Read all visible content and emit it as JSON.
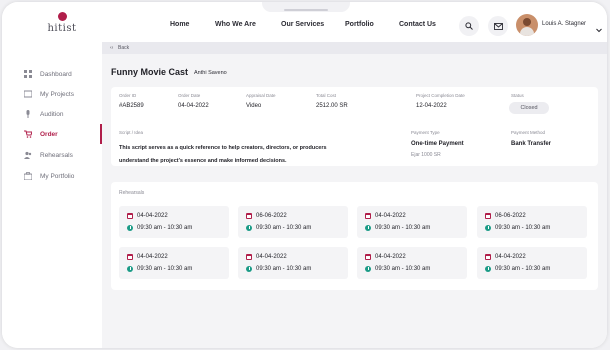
{
  "brand": {
    "logo_text": "hitist",
    "accent": "#b01e4a",
    "time_icon_color": "#1a9b86"
  },
  "nav": {
    "links": [
      "Home",
      "Who We Are",
      "Our Services",
      "Portfolio",
      "Contact Us"
    ],
    "user_name": "Louis A. Stagner"
  },
  "sidebar": {
    "items": [
      {
        "label": "Dashboard",
        "icon": "grid-icon"
      },
      {
        "label": "My Projects",
        "icon": "folder-icon"
      },
      {
        "label": "Audition",
        "icon": "mic-icon"
      },
      {
        "label": "Order",
        "icon": "cart-icon",
        "active": true
      },
      {
        "label": "Rehearsals",
        "icon": "users-icon"
      },
      {
        "label": "My Portfolio",
        "icon": "briefcase-icon"
      }
    ]
  },
  "back_label": "Back",
  "page": {
    "title": "Funny Movie Cast",
    "subtitle": "Anthi Saveno"
  },
  "order": {
    "fields": [
      {
        "label": "Order ID",
        "value": "#AB2589"
      },
      {
        "label": "Order Date",
        "value": "04-04-2022"
      },
      {
        "label": "Appraisal Date",
        "value": "Video"
      },
      {
        "label": "Total Cost",
        "value": "2512.00 SR"
      },
      {
        "label": "Project Completion Date",
        "value": "12-04-2022"
      }
    ],
    "status_label": "Status",
    "status_value": "Closed",
    "script_label": "Script / Idea",
    "script_text": "This script serves as a quick reference to help creators, directors, or producers understand the project's essence and make informed decisions.",
    "payment_type_label": "Payment Type",
    "payment_type_value": "One-time Payment",
    "payment_type_note": "Ejar 1000 SR",
    "payment_method_label": "Payment Method",
    "payment_method_value": "Bank Transfer"
  },
  "rehearsals": {
    "title": "Rehearsals",
    "items": [
      {
        "date": "04-04-2022",
        "time": "09:30 am - 10:30 am"
      },
      {
        "date": "06-06-2022",
        "time": "09:30 am - 10:30 am"
      },
      {
        "date": "04-04-2022",
        "time": "09:30 am - 10:30 am"
      },
      {
        "date": "06-06-2022",
        "time": "09:30 am - 10:30 am"
      },
      {
        "date": "04-04-2022",
        "time": "09:30 am - 10:30 am"
      },
      {
        "date": "04-04-2022",
        "time": "09:30 am - 10:30 am"
      },
      {
        "date": "04-04-2022",
        "time": "09:30 am - 10:30 am"
      },
      {
        "date": "04-04-2022",
        "time": "09:30 am - 10:30 am"
      }
    ]
  }
}
